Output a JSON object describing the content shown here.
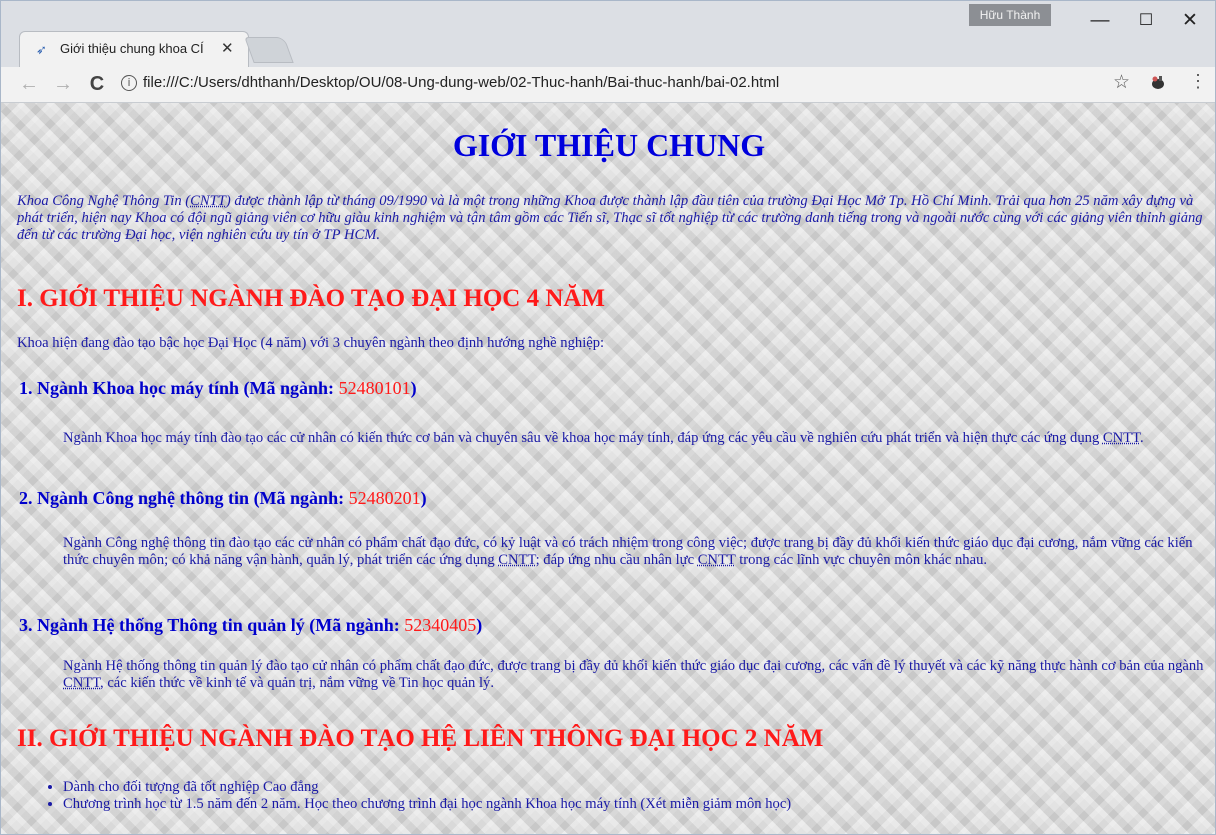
{
  "browser": {
    "tab_title": "Giới thiệu chung khoa CÍ",
    "tab_close": "✕",
    "user_name": "Hữu Thành",
    "minimize": "—",
    "maximize": "☐",
    "close": "✕",
    "back": "←",
    "forward": "→",
    "reload": "C",
    "info": "i",
    "url": "file:///C:/Users/dhthanh/Desktop/OU/08-Ung-dung-web/02-Thuc-hanh/Bai-thuc-hanh/bai-02.html",
    "star": "☆",
    "menu": "⋮"
  },
  "page": {
    "title": "GIỚI THIỆU CHUNG",
    "intro_a": "Khoa Công Nghệ Thông Tin (",
    "intro_abbr": "CNTT",
    "intro_b": ") được thành lập từ tháng 09/1990 và là một trong những Khoa được thành lập đầu tiên của trường Đại Học Mở Tp. Hồ Chí Minh. Trải qua hơn 25 năm xây dựng và phát triển, hiện nay Khoa có đội ngũ giảng viên cơ hữu giàu kinh nghiệm và tận tâm gồm các Tiến sĩ, Thạc sĩ tốt nghiệp từ các trường danh tiếng trong và ngoài nước cùng với các giảng viên thỉnh giảng đến từ các trường Đại học, viện nghiên cứu uy tín ở TP HCM.",
    "section1_title": "I. GIỚI THIỆU NGÀNH ĐÀO TẠO ĐẠI HỌC 4 NĂM",
    "section1_lead": "Khoa hiện đang đào tạo bậc học Đại Học (4 năm) với 3 chuyên ngành theo định hướng nghề nghiệp:",
    "majors": [
      {
        "heading": "1. Ngành Khoa học máy tính (Mã ngành: ",
        "code": "52480101",
        "close": ")",
        "desc_a": "Ngành Khoa học máy tính đào tạo các cử nhân có kiến thức cơ bản và chuyên sâu về khoa học máy tính, đáp ứng các yêu cầu về nghiên cứu phát triển và hiện thực các ứng dụng ",
        "desc_abbr": "CNTT",
        "desc_b": "."
      },
      {
        "heading": "2. Ngành Công nghệ thông tin (Mã ngành: ",
        "code": "52480201",
        "close": ")",
        "desc_a": "Ngành Công nghệ thông tin đào tạo các cử nhân có phẩm chất đạo đức, có kỷ luật và có trách nhiệm trong công việc; được trang bị đầy đủ khối kiến thức giáo dục đại cương, nắm vững các kiến thức chuyên môn; có khả năng vận hành, quản lý, phát triển các ứng dụng ",
        "desc_abbr": "CNTT",
        "desc_b": "; đáp ứng nhu cầu nhân lực ",
        "desc_abbr2": "CNTT",
        "desc_c": " trong các lĩnh vực chuyên môn khác nhau."
      },
      {
        "heading": "3. Ngành Hệ thống Thông tin quản lý (Mã ngành: ",
        "code": "52340405",
        "close": ")",
        "desc_a": "Ngành Hệ thống thông tin quản lý đào tạo cử nhân có phẩm chất đạo đức, được trang bị đầy đủ khối kiến thức giáo dục đại cương, các vấn đề lý thuyết và các kỹ năng thực hành cơ bản của ngành ",
        "desc_abbr": "CNTT",
        "desc_b": ", các kiến thức về kinh tế và quản trị, nắm vững về Tin học quản lý."
      }
    ],
    "section2_title": "II. GIỚI THIỆU NGÀNH ĐÀO TẠO HỆ LIÊN THÔNG ĐẠI HỌC 2 NĂM",
    "section2_bullets": [
      "Dành cho đối tượng đã tốt nghiệp Cao đẳng",
      "Chương trình học từ 1.5 năm đến 2 năm. Học theo chương trình đại học ngành Khoa học máy tính (Xét miễn giảm môn học)"
    ]
  },
  "colors": {
    "heading_blue": "#0000dd",
    "section_red": "#ff1a1a",
    "text_blue": "#1a1aa6"
  }
}
